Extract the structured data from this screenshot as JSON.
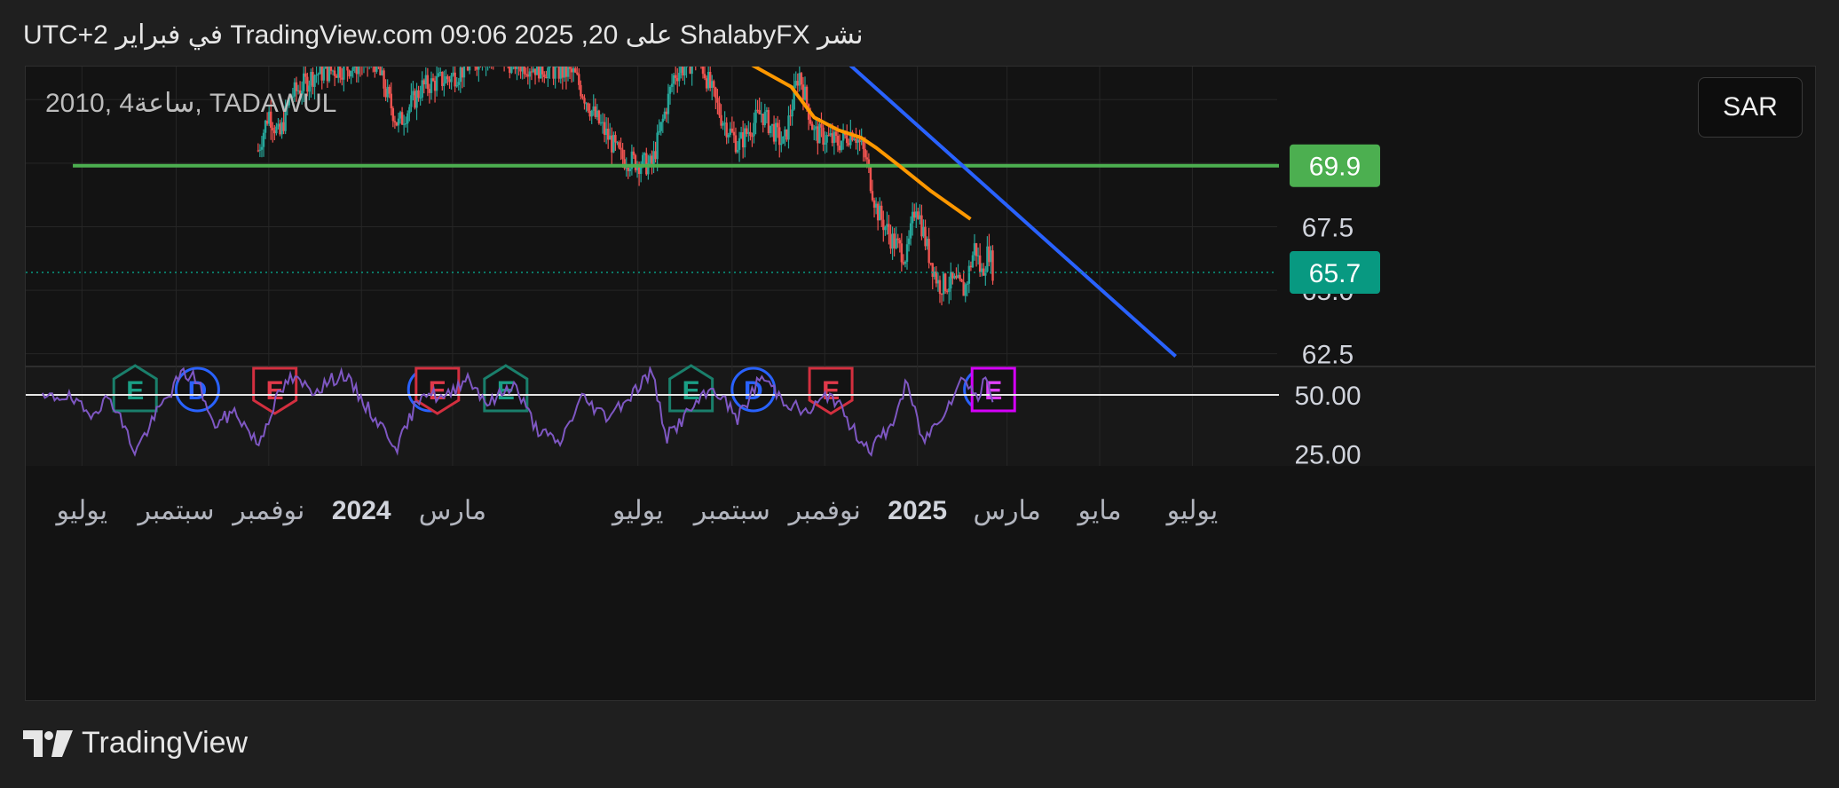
{
  "header": {
    "text": "نشر ShalabyFX على TradingView.com 09:06 2025 ,20 في فبراير UTC+2"
  },
  "symbol_info": "2010, 4ساعة, TADAWUL",
  "currency_button": "SAR",
  "footer": {
    "brand": "TradingView"
  },
  "colors": {
    "background": "#131313",
    "up": "#26a69a",
    "down": "#ef5350",
    "support_line": "#4caf50",
    "moving_average": "#ff9800",
    "trendline": "#2962ff",
    "rsi": "#7e57c2",
    "current_price": "#089981"
  },
  "chart_data": [
    {
      "type": "candlestick",
      "x_axis_labels": [
        "يوليو",
        "سبتمبر",
        "نوفمبر",
        "2024",
        "مارس",
        "يوليو",
        "سبتمبر",
        "نوفمبر",
        "2025",
        "مارس",
        "مايو",
        "يوليو"
      ],
      "y_ticks": [
        62.5,
        65.0,
        67.5
      ],
      "price_labels": {
        "support": 69.9,
        "last": 65.7
      },
      "ylim": [
        62.0,
        73.8
      ],
      "close_series": [
        {
          "d": "2023-10-25",
          "c": 70.5
        },
        {
          "d": "2023-11-01",
          "c": 72.0
        },
        {
          "d": "2023-11-08",
          "c": 71.0
        },
        {
          "d": "2023-11-15",
          "c": 72.6
        },
        {
          "d": "2023-12-01",
          "c": 73.5
        },
        {
          "d": "2024-01-10",
          "c": 74.0
        },
        {
          "d": "2024-01-25",
          "c": 71.5
        },
        {
          "d": "2024-02-10",
          "c": 73.0
        },
        {
          "d": "2024-03-01",
          "c": 73.4
        },
        {
          "d": "2024-03-20",
          "c": 74.2
        },
        {
          "d": "2024-05-20",
          "c": 73.5
        },
        {
          "d": "2024-06-01",
          "c": 72.0
        },
        {
          "d": "2024-06-20",
          "c": 70.2
        },
        {
          "d": "2024-07-10",
          "c": 69.9
        },
        {
          "d": "2024-07-25",
          "c": 73.5
        },
        {
          "d": "2024-08-10",
          "c": 74.2
        },
        {
          "d": "2024-08-25",
          "c": 71.8
        },
        {
          "d": "2024-09-05",
          "c": 70.7
        },
        {
          "d": "2024-09-20",
          "c": 72.0
        },
        {
          "d": "2024-10-05",
          "c": 70.7
        },
        {
          "d": "2024-10-15",
          "c": 73.6
        },
        {
          "d": "2024-10-25",
          "c": 71.2
        },
        {
          "d": "2024-11-10",
          "c": 70.8
        },
        {
          "d": "2024-11-20",
          "c": 71.3
        },
        {
          "d": "2024-11-28",
          "c": 70.2
        },
        {
          "d": "2024-12-05",
          "c": 68.2
        },
        {
          "d": "2024-12-15",
          "c": 67.0
        },
        {
          "d": "2024-12-25",
          "c": 66.3
        },
        {
          "d": "2024-12-31",
          "c": 68.5
        },
        {
          "d": "2025-01-08",
          "c": 66.5
        },
        {
          "d": "2025-01-15",
          "c": 65.2
        },
        {
          "d": "2025-01-25",
          "c": 65.3
        },
        {
          "d": "2025-02-01",
          "c": 65.0
        },
        {
          "d": "2025-02-08",
          "c": 66.8
        },
        {
          "d": "2025-02-12",
          "c": 65.6
        },
        {
          "d": "2025-02-17",
          "c": 66.6
        },
        {
          "d": "2025-02-20",
          "c": 65.7
        }
      ],
      "moving_average": [
        {
          "d": "2024-08-20",
          "v": 74.5
        },
        {
          "d": "2024-09-10",
          "v": 74.0
        },
        {
          "d": "2024-10-10",
          "v": 73.0
        },
        {
          "d": "2024-10-25",
          "v": 71.8
        },
        {
          "d": "2024-11-10",
          "v": 71.3
        },
        {
          "d": "2024-11-25",
          "v": 71.0
        },
        {
          "d": "2024-12-05",
          "v": 70.6
        },
        {
          "d": "2024-12-20",
          "v": 69.9
        },
        {
          "d": "2025-01-10",
          "v": 68.9
        },
        {
          "d": "2025-02-05",
          "v": 67.8
        }
      ],
      "trendline": {
        "from": {
          "d": "2024-11-15",
          "v": 74.0
        },
        "to": {
          "d": "2025-06-20",
          "v": 62.4
        }
      },
      "support_level": 69.9,
      "event_markers": [
        {
          "d": "2023-08-05",
          "label": "E",
          "kind": "earnings-past"
        },
        {
          "d": "2023-09-15",
          "label": "D",
          "kind": "dividend"
        },
        {
          "d": "2023-11-05",
          "label": "E",
          "kind": "earnings-miss"
        },
        {
          "d": "2024-02-15",
          "label": "D",
          "kind": "dividend"
        },
        {
          "d": "2024-02-20",
          "label": "E",
          "kind": "earnings-miss"
        },
        {
          "d": "2024-04-05",
          "label": "E",
          "kind": "earnings-past"
        },
        {
          "d": "2024-08-05",
          "label": "E",
          "kind": "earnings-past"
        },
        {
          "d": "2024-09-15",
          "label": "D",
          "kind": "dividend"
        },
        {
          "d": "2024-11-05",
          "label": "E",
          "kind": "earnings-miss"
        },
        {
          "d": "2025-02-15",
          "label": "D",
          "kind": "dividend"
        },
        {
          "d": "2025-02-20",
          "label": "E",
          "kind": "earnings-upcoming"
        }
      ]
    },
    {
      "type": "line",
      "name": "RSI",
      "y_ticks": [
        25.0,
        50.0
      ],
      "reference_level": 50.0,
      "ylim": [
        20,
        62
      ],
      "series": [
        {
          "d": "2023-06-05",
          "v": 48
        },
        {
          "d": "2023-06-20",
          "v": 50
        },
        {
          "d": "2023-07-05",
          "v": 42
        },
        {
          "d": "2023-07-20",
          "v": 49
        },
        {
          "d": "2023-08-05",
          "v": 26
        },
        {
          "d": "2023-08-20",
          "v": 43
        },
        {
          "d": "2023-09-05",
          "v": 59
        },
        {
          "d": "2023-09-15",
          "v": 57
        },
        {
          "d": "2023-09-25",
          "v": 37
        },
        {
          "d": "2023-10-10",
          "v": 43
        },
        {
          "d": "2023-10-25",
          "v": 29
        },
        {
          "d": "2023-11-05",
          "v": 47
        },
        {
          "d": "2023-11-15",
          "v": 57
        },
        {
          "d": "2023-12-01",
          "v": 52
        },
        {
          "d": "2023-12-20",
          "v": 59
        },
        {
          "d": "2024-01-10",
          "v": 40
        },
        {
          "d": "2024-01-25",
          "v": 28
        },
        {
          "d": "2024-02-10",
          "v": 52
        },
        {
          "d": "2024-02-25",
          "v": 48
        },
        {
          "d": "2024-03-10",
          "v": 58
        },
        {
          "d": "2024-03-25",
          "v": 46
        },
        {
          "d": "2024-04-10",
          "v": 55
        },
        {
          "d": "2024-04-25",
          "v": 36
        },
        {
          "d": "2024-05-10",
          "v": 29
        },
        {
          "d": "2024-05-25",
          "v": 49
        },
        {
          "d": "2024-06-10",
          "v": 41
        },
        {
          "d": "2024-06-25",
          "v": 49
        },
        {
          "d": "2024-07-10",
          "v": 60
        },
        {
          "d": "2024-07-20",
          "v": 32
        },
        {
          "d": "2024-08-05",
          "v": 44
        },
        {
          "d": "2024-08-20",
          "v": 53
        },
        {
          "d": "2024-09-05",
          "v": 40
        },
        {
          "d": "2024-09-20",
          "v": 58
        },
        {
          "d": "2024-10-05",
          "v": 48
        },
        {
          "d": "2024-10-20",
          "v": 42
        },
        {
          "d": "2024-11-05",
          "v": 51
        },
        {
          "d": "2024-11-20",
          "v": 35
        },
        {
          "d": "2024-12-01",
          "v": 27
        },
        {
          "d": "2024-12-15",
          "v": 37
        },
        {
          "d": "2024-12-25",
          "v": 55
        },
        {
          "d": "2025-01-05",
          "v": 30
        },
        {
          "d": "2025-01-20",
          "v": 45
        },
        {
          "d": "2025-02-01",
          "v": 58
        },
        {
          "d": "2025-02-10",
          "v": 48
        },
        {
          "d": "2025-02-15",
          "v": 58
        },
        {
          "d": "2025-02-20",
          "v": 49
        }
      ]
    }
  ]
}
